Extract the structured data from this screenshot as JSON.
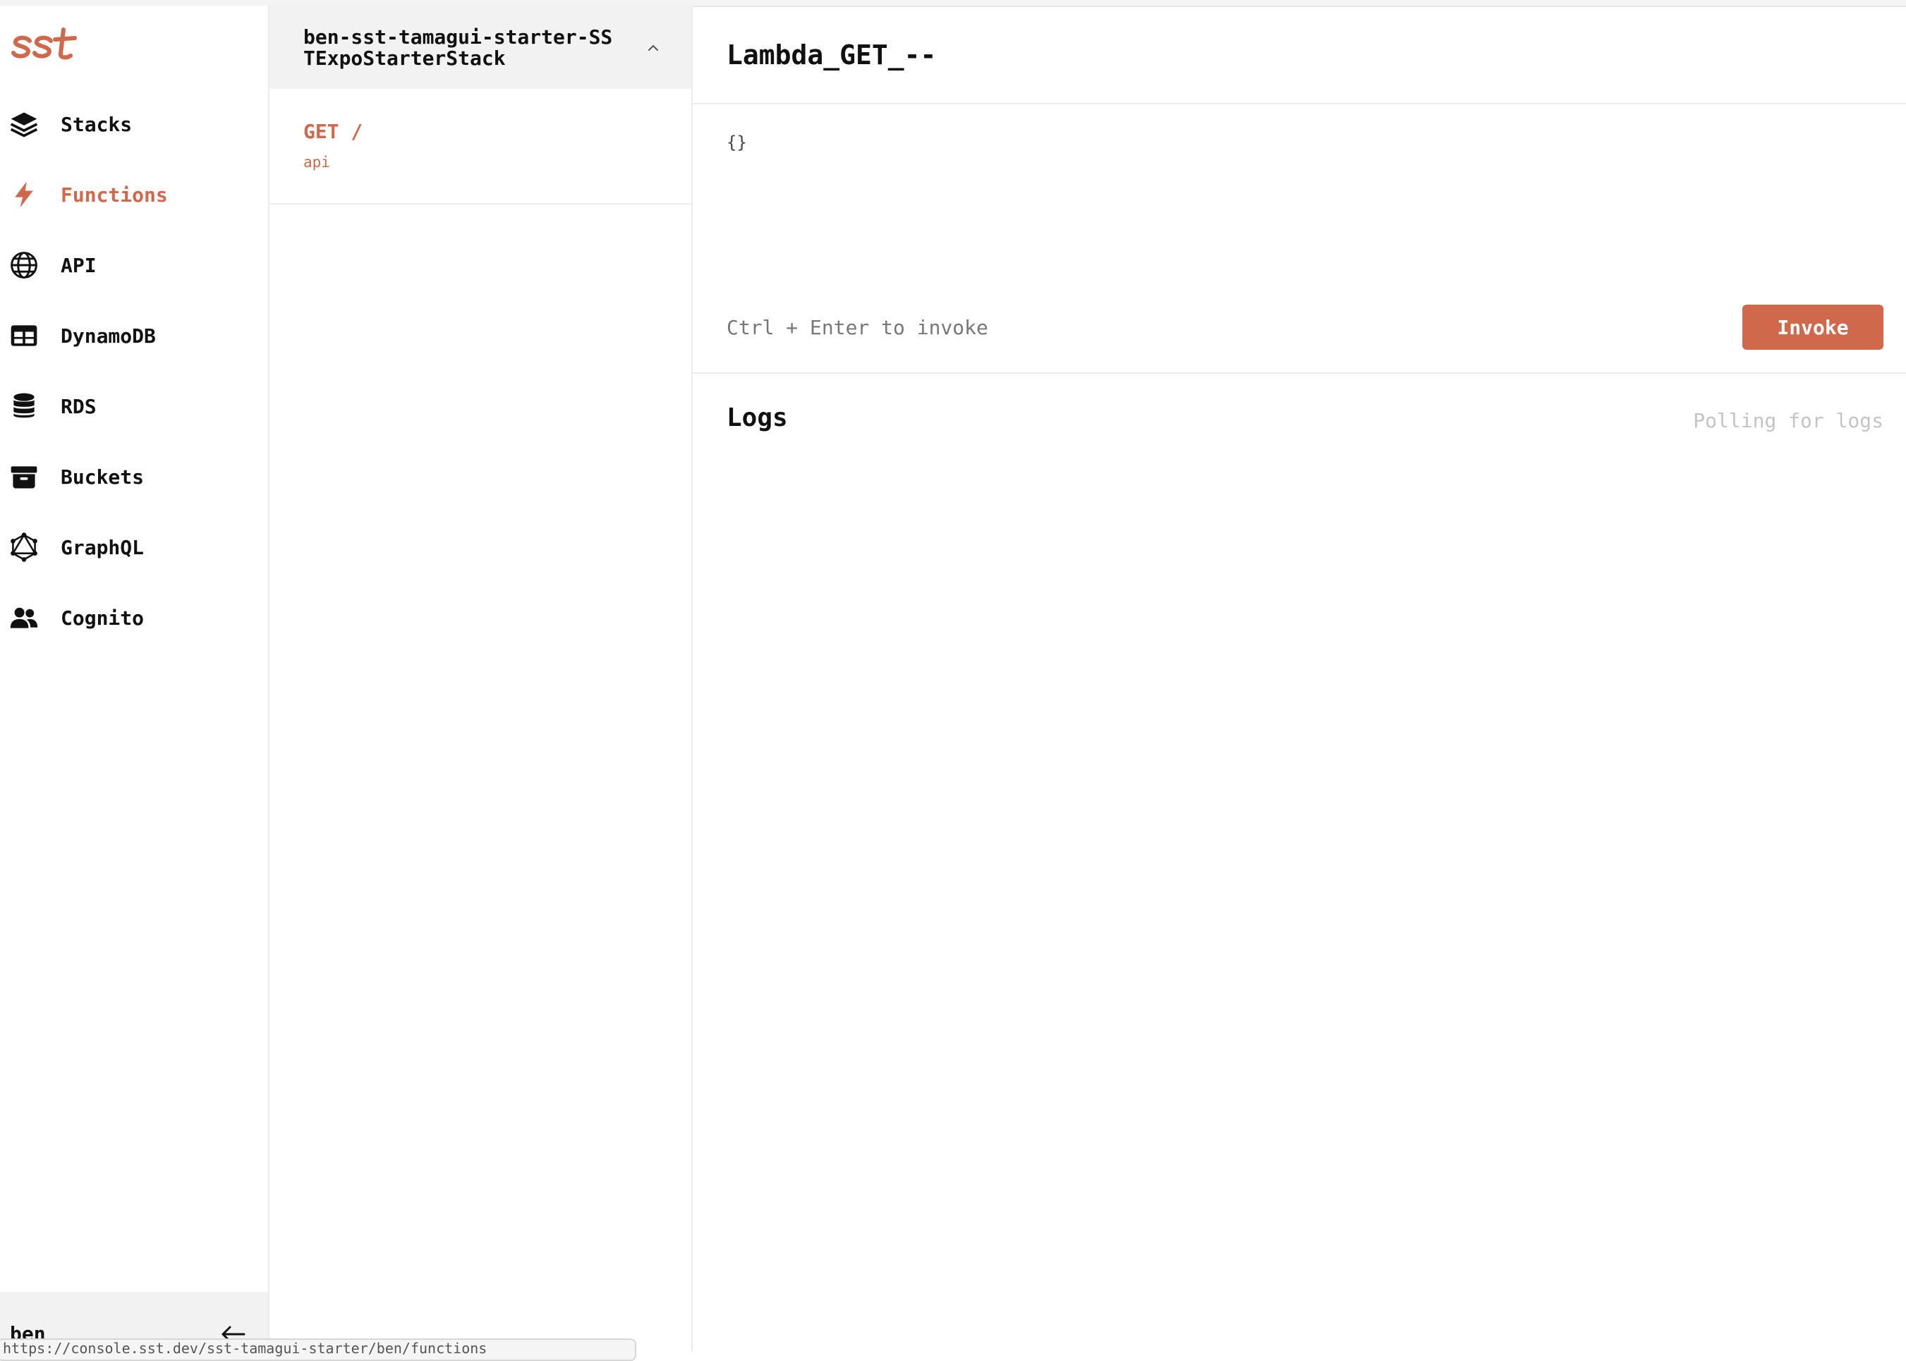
{
  "app": {
    "logo_text": "sst",
    "accent": "#d0684c"
  },
  "sidebar": {
    "items": [
      {
        "label": "Stacks",
        "icon": "layers-icon"
      },
      {
        "label": "Functions",
        "icon": "bolt-icon",
        "active": true
      },
      {
        "label": "API",
        "icon": "globe-icon"
      },
      {
        "label": "DynamoDB",
        "icon": "table-icon"
      },
      {
        "label": "RDS",
        "icon": "database-icon"
      },
      {
        "label": "Buckets",
        "icon": "archive-icon"
      },
      {
        "label": "GraphQL",
        "icon": "graphql-icon"
      },
      {
        "label": "Cognito",
        "icon": "users-icon"
      }
    ],
    "user": "ben",
    "collapse_icon": "arrow-left-icon"
  },
  "status_bar": {
    "url": "https://console.sst.dev/sst-tamagui-starter/ben/functions"
  },
  "list": {
    "stack_name": "ben-sst-tamagui-starter-SSTExpoStarterStack",
    "functions": [
      {
        "title": "GET /",
        "subtitle": "api"
      }
    ]
  },
  "main": {
    "title": "Lambda_GET_--",
    "payload": "{}",
    "hint": "Ctrl + Enter to invoke",
    "invoke_label": "Invoke",
    "logs_title": "Logs",
    "logs_status": "Polling for logs"
  }
}
